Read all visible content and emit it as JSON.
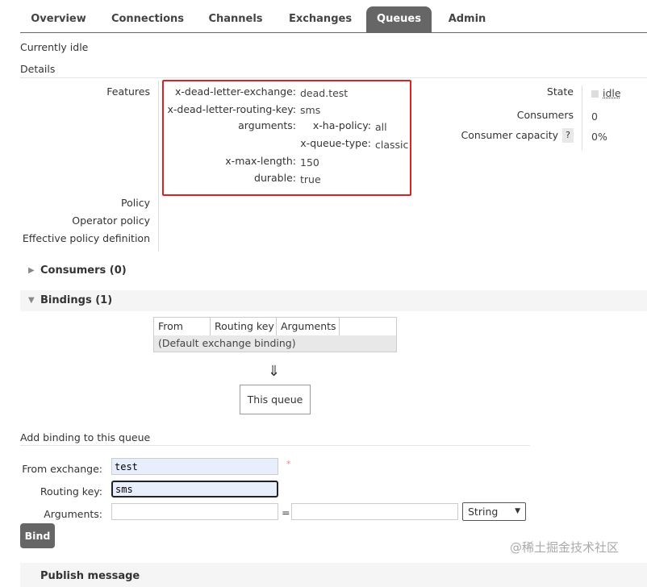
{
  "tabs": [
    "Overview",
    "Connections",
    "Channels",
    "Exchanges",
    "Queues",
    "Admin"
  ],
  "status": "Currently idle",
  "details_title": "Details",
  "features_label": "Features",
  "features": [
    {
      "k": "x-dead-letter-exchange:",
      "v": "dead.test"
    },
    {
      "k": "x-dead-letter-routing-key:",
      "v": "sms"
    },
    {
      "k": "arguments:",
      "v": ""
    },
    {
      "k": "x-ha-policy:",
      "v": "all"
    },
    {
      "k": "x-queue-type:",
      "v": "classic"
    },
    {
      "k": "x-max-length:",
      "v": "150"
    },
    {
      "k": "durable:",
      "v": "true"
    }
  ],
  "policy_labels": [
    "Policy",
    "Operator policy",
    "Effective policy definition"
  ],
  "state": {
    "label": "State",
    "value": "idle"
  },
  "consumers": {
    "label": "Consumers",
    "value": "0"
  },
  "capacity": {
    "label": "Consumer capacity",
    "help": "?",
    "value": "0%"
  },
  "consumers_section": "Consumers (0)",
  "bindings_section": "Bindings (1)",
  "bindings_table": {
    "headers": [
      "From",
      "Routing key",
      "Arguments",
      ""
    ],
    "row": "(Default exchange binding)"
  },
  "arrow": "⇓",
  "this_queue": "This queue",
  "add_binding": {
    "title": "Add binding to this queue",
    "from_label": "From exchange:",
    "from_value": "test",
    "required": "*",
    "key_label": "Routing key:",
    "key_value": "sms",
    "args_label": "Arguments:",
    "eq": "=",
    "type": "String",
    "bind": "Bind"
  },
  "next_section": "Publish message",
  "watermark": "@稀土掘金技术社区",
  "colors": {
    "highlight": "#e02020",
    "tab_active": "#666666"
  }
}
